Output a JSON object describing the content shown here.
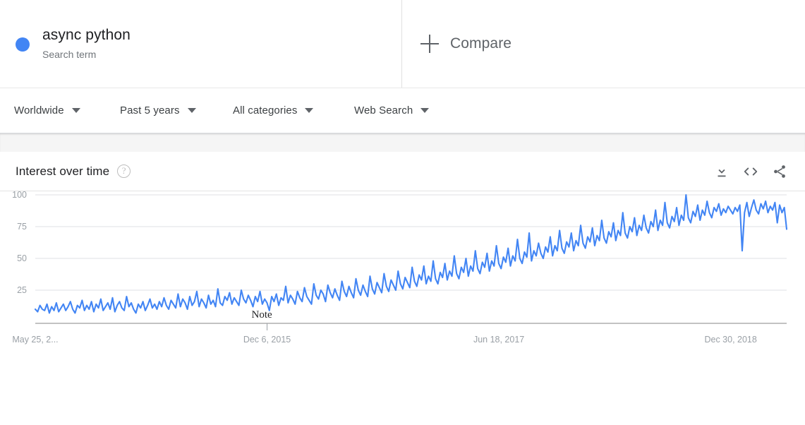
{
  "search_term": {
    "dot_color": "#4285f4",
    "title": "async python",
    "subtitle": "Search term"
  },
  "compare": {
    "label": "Compare",
    "icon": "plus-icon"
  },
  "filters": [
    {
      "label": "Worldwide",
      "icon": "chevron-down-icon"
    },
    {
      "label": "Past 5 years",
      "icon": "chevron-down-icon"
    },
    {
      "label": "All categories",
      "icon": "chevron-down-icon"
    },
    {
      "label": "Web Search",
      "icon": "chevron-down-icon"
    }
  ],
  "card": {
    "title": "Interest over time",
    "help_icon": "?",
    "actions": [
      {
        "name": "download-icon",
        "tooltip": "Download"
      },
      {
        "name": "embed-code-icon",
        "tooltip": "Embed"
      },
      {
        "name": "share-icon",
        "tooltip": "Share"
      }
    ]
  },
  "annotation": {
    "label": "Note"
  },
  "chart_data": {
    "type": "line",
    "title": "Interest over time",
    "xlabel": "",
    "ylabel": "",
    "ylim": [
      0,
      100
    ],
    "yticks": [
      25,
      50,
      75,
      100
    ],
    "grid": true,
    "legend": false,
    "line_color": "#4285f4",
    "x_tick_labels": [
      "May 25, 2...",
      "Dec 6, 2015",
      "Jun 18, 2017",
      "Dec 30, 2018"
    ],
    "x_tick_positions": [
      0,
      0.3085,
      0.617,
      0.9255
    ],
    "series": [
      {
        "name": "async python",
        "values": [
          10,
          8,
          13,
          10,
          9,
          14,
          7,
          12,
          9,
          15,
          8,
          11,
          14,
          9,
          12,
          16,
          10,
          7,
          13,
          11,
          17,
          9,
          13,
          10,
          16,
          8,
          14,
          11,
          18,
          9,
          12,
          15,
          10,
          19,
          8,
          13,
          16,
          11,
          9,
          20,
          12,
          15,
          10,
          7,
          14,
          11,
          16,
          9,
          13,
          18,
          11,
          14,
          10,
          16,
          12,
          19,
          13,
          10,
          17,
          14,
          11,
          22,
          12,
          18,
          15,
          10,
          20,
          13,
          16,
          24,
          12,
          18,
          15,
          11,
          21,
          14,
          17,
          12,
          26,
          15,
          13,
          20,
          17,
          23,
          14,
          19,
          16,
          13,
          25,
          18,
          15,
          21,
          17,
          12,
          20,
          16,
          24,
          14,
          18,
          15,
          9,
          20,
          16,
          22,
          13,
          19,
          17,
          28,
          15,
          21,
          18,
          14,
          24,
          19,
          16,
          27,
          20,
          17,
          14,
          30,
          21,
          18,
          25,
          22,
          16,
          29,
          23,
          19,
          26,
          21,
          17,
          32,
          24,
          20,
          28,
          23,
          19,
          34,
          25,
          21,
          29,
          24,
          20,
          36,
          26,
          22,
          31,
          27,
          23,
          38,
          28,
          24,
          33,
          29,
          25,
          40,
          30,
          26,
          35,
          31,
          27,
          43,
          32,
          28,
          37,
          33,
          44,
          30,
          36,
          32,
          48,
          34,
          30,
          39,
          35,
          46,
          33,
          40,
          36,
          52,
          38,
          34,
          43,
          39,
          50,
          36,
          44,
          40,
          56,
          42,
          38,
          47,
          43,
          54,
          40,
          48,
          44,
          60,
          46,
          42,
          51,
          47,
          58,
          44,
          52,
          48,
          65,
          50,
          46,
          55,
          51,
          70,
          48,
          56,
          52,
          62,
          54,
          50,
          59,
          55,
          67,
          52,
          60,
          56,
          72,
          58,
          54,
          63,
          59,
          70,
          56,
          64,
          60,
          76,
          62,
          58,
          67,
          63,
          74,
          60,
          68,
          64,
          80,
          66,
          62,
          71,
          67,
          78,
          64,
          72,
          68,
          86,
          70,
          66,
          75,
          71,
          82,
          68,
          76,
          72,
          84,
          74,
          70,
          79,
          75,
          88,
          72,
          80,
          76,
          94,
          78,
          74,
          83,
          79,
          90,
          76,
          84,
          80,
          100,
          82,
          78,
          87,
          83,
          92,
          80,
          88,
          84,
          95,
          86,
          82,
          90,
          87,
          93,
          84,
          89,
          86,
          91,
          88,
          85,
          90,
          87,
          92,
          56,
          86,
          94,
          83,
          90,
          96,
          88,
          85,
          93,
          89,
          95,
          86,
          91,
          88,
          94,
          78,
          92,
          86,
          90,
          73
        ]
      }
    ],
    "peak": {
      "value": 100,
      "approx_date": "late 2018"
    },
    "notes": "Steadily rising search interest with weekly oscillation; sharp holiday dips near the end."
  }
}
